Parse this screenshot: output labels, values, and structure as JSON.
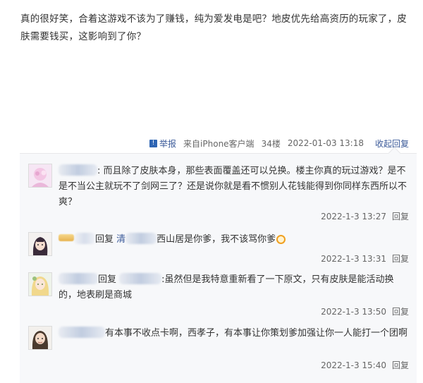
{
  "post": {
    "text": "真的很好笑，合着这游戏不该为了赚钱，纯为爱发电是吧？地皮优先给高资历的玩家了，皮肤需要钱买，这影响到了你？"
  },
  "post_meta": {
    "report_label": "举报",
    "source": "来自iPhone客户端",
    "floor": "34楼",
    "timestamp": "2022-01-03 13:18",
    "collapse_label": "收起回复"
  },
  "replies": [
    {
      "text": ": 而且除了皮肤本身，那些表面覆盖还可以兑换。楼主你真的玩过游戏？是不是不当公主就玩不了剑网三了？还是说你就是看不惯别人花钱能得到你同样东西所以不爽？",
      "time": "2022-1-3 13:27",
      "reply_label": "回复"
    },
    {
      "reply_word": "回复",
      "at_prefix": "清",
      "text": "西山居是你爹，我不该骂你爹",
      "time": "2022-1-3 13:31",
      "reply_label": "回复"
    },
    {
      "reply_word": "回复",
      "text": ":虽然但是我特意重新看了一下原文，只有皮肤是能活动换的，地表刷是商城",
      "time": "2022-1-3 13:50",
      "reply_label": "回复"
    },
    {
      "text": "有本事不收点卡啊，西孝子，有本事让你策划爹加强让你一人能打一个团啊",
      "time": "2022-1-3 15:40",
      "reply_label": "回复"
    }
  ]
}
